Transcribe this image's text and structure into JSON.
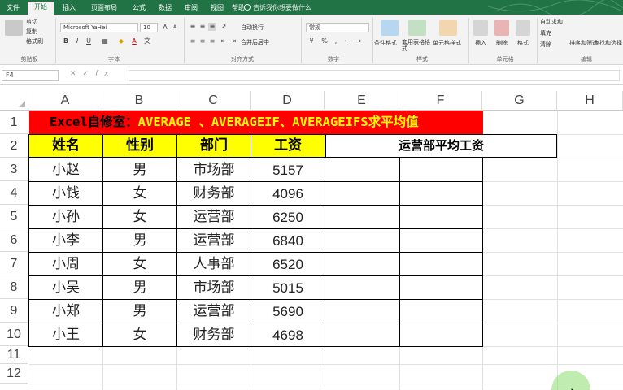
{
  "ribbon": {
    "tabs": [
      "文件",
      "开始",
      "插入",
      "页面布局",
      "公式",
      "数据",
      "审阅",
      "视图",
      "帮助"
    ],
    "active_tab": "开始",
    "tell_me": "告诉我你想要做什么",
    "font_name": "Microsoft YaHei",
    "font_size": "10",
    "number_format": "常规",
    "clipboard": {
      "cut": "剪切",
      "copy": "复制",
      "format_painter": "格式刷",
      "label": "剪贴板"
    },
    "font_group_label": "字体",
    "align_group_label": "对齐方式",
    "wrap_text": "自动换行",
    "merge_center": "合并后居中",
    "number_group_label": "数字",
    "styles": {
      "conditional": "条件格式",
      "table": "套用表格格式",
      "cell": "单元格样式",
      "label": "样式"
    },
    "cells": {
      "insert": "插入",
      "delete": "删除",
      "format": "格式",
      "label": "单元格"
    },
    "editing": {
      "autosum": "自动求和",
      "fill": "填充",
      "clear": "清除",
      "sort": "排序和筛选",
      "find": "查找和选择",
      "label": "编辑"
    }
  },
  "formula_bar": {
    "name_box": "F4",
    "formula": ""
  },
  "columns": [
    "A",
    "B",
    "C",
    "D",
    "E",
    "F",
    "G",
    "H"
  ],
  "rows": [
    "1",
    "2",
    "3",
    "4",
    "5",
    "6",
    "7",
    "8",
    "9",
    "10",
    "11",
    "12"
  ],
  "sheet": {
    "title_prefix": "Excel自修室：",
    "title_rest": "AVERAGE 、AVERAGEIF、AVERAGEIFS求平均值",
    "headers": [
      "姓名",
      "性别",
      "部门",
      "工资"
    ],
    "merged_header": "运营部平均工资",
    "records": [
      {
        "name": "小赵",
        "gender": "男",
        "dept": "市场部",
        "salary": "5157"
      },
      {
        "name": "小钱",
        "gender": "女",
        "dept": "财务部",
        "salary": "4096"
      },
      {
        "name": "小孙",
        "gender": "女",
        "dept": "运营部",
        "salary": "6250"
      },
      {
        "name": "小李",
        "gender": "男",
        "dept": "运营部",
        "salary": "6840"
      },
      {
        "name": "小周",
        "gender": "女",
        "dept": "人事部",
        "salary": "6520"
      },
      {
        "name": "小吴",
        "gender": "男",
        "dept": "市场部",
        "salary": "5015"
      },
      {
        "name": "小郑",
        "gender": "男",
        "dept": "运营部",
        "salary": "5690"
      },
      {
        "name": "小王",
        "gender": "女",
        "dept": "财务部",
        "salary": "4698"
      }
    ]
  },
  "colors": {
    "ribbon_green": "#217346",
    "title_bg": "#ff0000",
    "title_text": "#ffff00",
    "header_bg": "#ffff00",
    "cursor_highlight": "#8cdc6e"
  }
}
